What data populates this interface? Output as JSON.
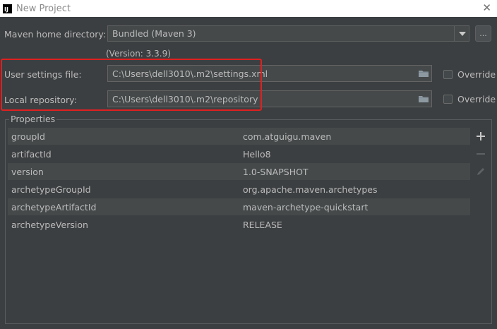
{
  "window": {
    "title": "New Project",
    "app_icon_text": "IJ"
  },
  "maven": {
    "home_label": "Maven home directory:",
    "home_value": "Bundled (Maven 3)",
    "browse_label": "...",
    "version_text": "(Version: 3.3.9)",
    "user_settings_label": "User settings file:",
    "user_settings_value": "C:\\Users\\dell3010\\.m2\\settings.xml",
    "local_repo_label": "Local repository:",
    "local_repo_value": "C:\\Users\\dell3010\\.m2\\repository",
    "override_label": "Override",
    "override_user_settings_checked": false,
    "override_local_repo_checked": false
  },
  "properties": {
    "title": "Properties",
    "rows": [
      {
        "key": "groupId",
        "value": "com.atguigu.maven"
      },
      {
        "key": "artifactId",
        "value": "Hello8"
      },
      {
        "key": "version",
        "value": "1.0-SNAPSHOT"
      },
      {
        "key": "archetypeGroupId",
        "value": "org.apache.maven.archetypes"
      },
      {
        "key": "archetypeArtifactId",
        "value": "maven-archetype-quickstart"
      },
      {
        "key": "archetypeVersion",
        "value": "RELEASE"
      }
    ]
  },
  "icons": {
    "add": "plus-icon",
    "remove": "minus-icon",
    "edit": "pencil-icon",
    "folder": "folder-icon",
    "close": "close-icon",
    "dropdown": "chevron-down-icon"
  },
  "colors": {
    "background": "#3c3f41",
    "field_bg": "#45494a",
    "highlight_border": "#e02020",
    "text": "#bbbbbb"
  }
}
